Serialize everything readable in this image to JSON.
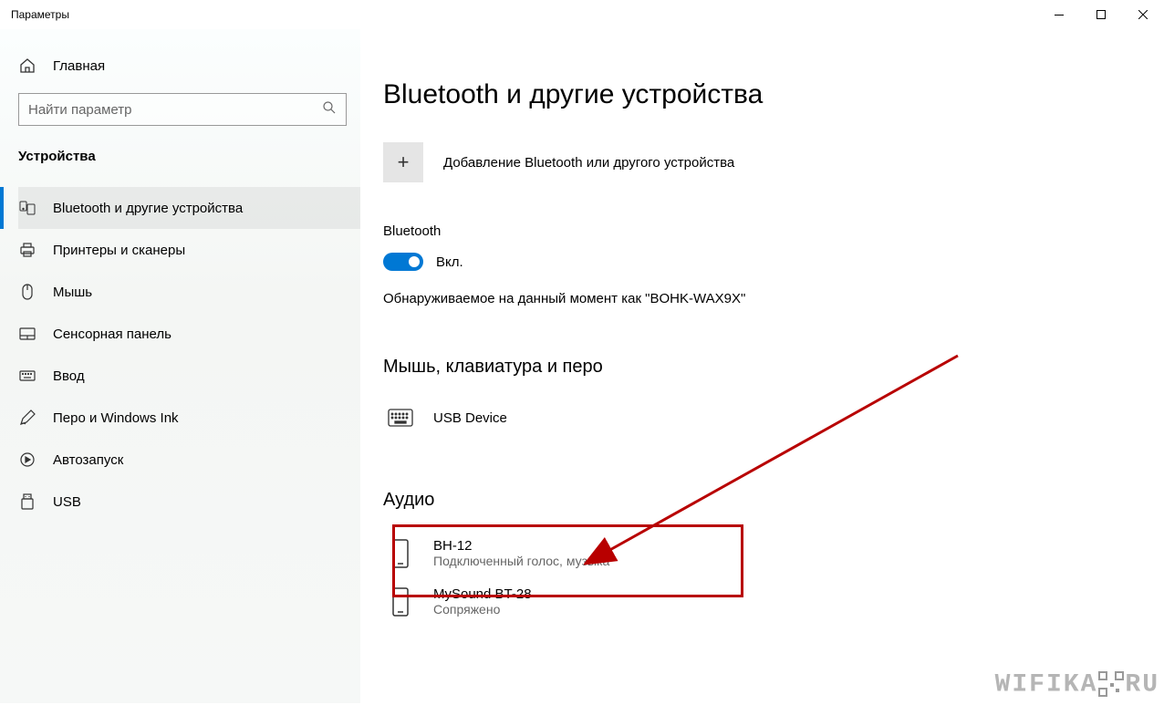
{
  "window": {
    "title": "Параметры"
  },
  "sidebar": {
    "home": "Главная",
    "search_placeholder": "Найти параметр",
    "category": "Устройства",
    "items": [
      {
        "label": "Bluetooth и другие устройства"
      },
      {
        "label": "Принтеры и сканеры"
      },
      {
        "label": "Мышь"
      },
      {
        "label": "Сенсорная панель"
      },
      {
        "label": "Ввод"
      },
      {
        "label": "Перо и Windows Ink"
      },
      {
        "label": "Автозапуск"
      },
      {
        "label": "USB"
      }
    ]
  },
  "content": {
    "title": "Bluetooth и другие устройства",
    "add_device": "Добавление Bluetooth или другого устройства",
    "bluetooth_label": "Bluetooth",
    "toggle_state": "Вкл.",
    "discoverable": "Обнаруживаемое на данный момент как \"BOHK-WAX9X\"",
    "section_input": "Мышь, клавиатура и перо",
    "input_devices": [
      {
        "name": "USB Device"
      }
    ],
    "section_audio": "Аудио",
    "audio_devices": [
      {
        "name": "BH-12",
        "status": "Подключенный голос, музыка"
      },
      {
        "name": "MySound BT-28",
        "status": "Сопряжено"
      }
    ]
  },
  "watermark": "WIFIKA RU"
}
